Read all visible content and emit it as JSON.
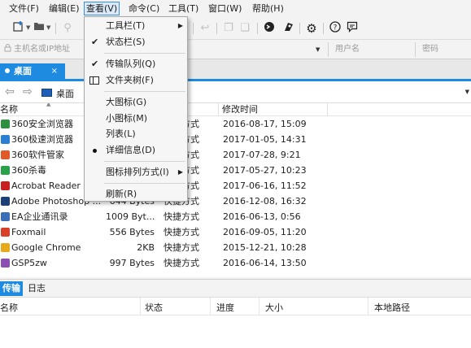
{
  "menubar": {
    "items": [
      {
        "label": "文件(F)"
      },
      {
        "label": "编辑(E)"
      },
      {
        "label": "查看(V)",
        "active": true
      },
      {
        "label": "命令(C)"
      },
      {
        "label": "工具(T)"
      },
      {
        "label": "窗口(W)"
      },
      {
        "label": "帮助(H)"
      }
    ]
  },
  "toolbar": {
    "icons": [
      "new-connection-icon",
      "open-folder-icon",
      "link-icon",
      "undo-icon",
      "copy-icon",
      "paste-icon",
      "shell-icon",
      "sync-icon",
      "settings-icon",
      "help-icon",
      "feedback-icon"
    ]
  },
  "connection_bar": {
    "host_placeholder": "主机名或IP地址",
    "username_placeholder": "用户名",
    "password_placeholder": "密码"
  },
  "tabs": {
    "active_tab": "桌面",
    "close_symbol": "×"
  },
  "path": {
    "current": "桌面"
  },
  "filelist": {
    "columns": {
      "name": "名称",
      "modified": "修改时间"
    },
    "rows": [
      {
        "name": "360安全浏览器",
        "size": "",
        "type": "快捷方式",
        "modified": "2016-08-17, 15:09",
        "icon_color": "#2f8f3f"
      },
      {
        "name": "360极速浏览器",
        "size": "",
        "type": "快捷方式",
        "modified": "2017-01-05, 14:31",
        "icon_color": "#2a7fd4"
      },
      {
        "name": "360软件管家",
        "size": "",
        "type": "快捷方式",
        "modified": "2017-07-28, 9:21",
        "icon_color": "#e05a2a"
      },
      {
        "name": "360杀毒",
        "size": "",
        "type": "快捷方式",
        "modified": "2017-05-27, 10:23",
        "icon_color": "#2aa04a"
      },
      {
        "name": "Acrobat Reader D",
        "size": "",
        "type": "快捷方式",
        "modified": "2017-06-16, 11:52",
        "icon_color": "#c8201e"
      },
      {
        "name": "Adobe Photoshop ...",
        "size": "644 Bytes",
        "type": "快捷方式",
        "modified": "2016-12-08, 16:32",
        "icon_color": "#1c3f78"
      },
      {
        "name": "EA企业通讯录",
        "size": "1009 Byt...",
        "type": "快捷方式",
        "modified": "2016-06-13, 0:56",
        "icon_color": "#3a6fb8"
      },
      {
        "name": "Foxmail",
        "size": "556 Bytes",
        "type": "快捷方式",
        "modified": "2016-09-05, 11:20",
        "icon_color": "#d8402a"
      },
      {
        "name": "Google Chrome",
        "size": "2KB",
        "type": "快捷方式",
        "modified": "2015-12-21, 10:28",
        "icon_color": "#e7a91c"
      },
      {
        "name": "GSP5zw",
        "size": "997 Bytes",
        "type": "快捷方式",
        "modified": "2016-06-14, 13:50",
        "icon_color": "#8a4fb0"
      }
    ]
  },
  "bottom_tabs": [
    {
      "label": "传输",
      "active": true
    },
    {
      "label": "日志",
      "active": false
    }
  ],
  "transfer_columns": {
    "name": "名称",
    "status": "状态",
    "progress": "进度",
    "size": "大小",
    "local_path": "本地路径"
  },
  "view_menu": {
    "items": [
      {
        "label": "工具栏(T)",
        "marker": "none",
        "submenu": true
      },
      {
        "label": "状态栏(S)",
        "marker": "check",
        "submenu": false
      },
      {
        "label": "传输队列(Q)",
        "marker": "check",
        "submenu": false
      },
      {
        "label": "文件夹树(F)",
        "marker": "folder-tree-icon",
        "submenu": false
      },
      {
        "label": "大图标(G)",
        "marker": "none",
        "submenu": false
      },
      {
        "label": "小图标(M)",
        "marker": "none",
        "submenu": false
      },
      {
        "label": "列表(L)",
        "marker": "none",
        "submenu": false
      },
      {
        "label": "详细信息(D)",
        "marker": "bullet",
        "submenu": false
      },
      {
        "label": "图标排列方式(I)",
        "marker": "none",
        "submenu": true
      },
      {
        "label": "刷新(R)",
        "marker": "none",
        "submenu": false
      }
    ],
    "check_symbol": "✔",
    "submenu_symbol": "▶"
  },
  "colors": {
    "accent": "#1e8be0",
    "menu_highlight": "#d9e9f8"
  }
}
